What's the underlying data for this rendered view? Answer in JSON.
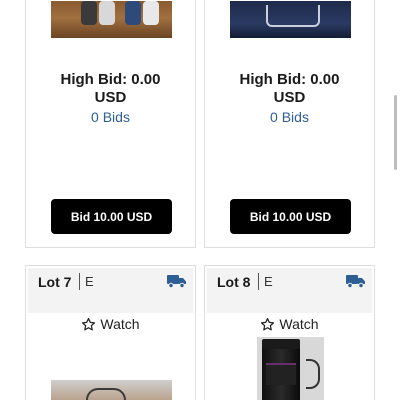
{
  "cards": [
    {
      "high_bid_label": "High Bid: 0.00",
      "currency": "USD",
      "bids_count": "0 Bids",
      "bid_button_label": "Bid 10.00 USD"
    },
    {
      "high_bid_label": "High Bid: 0.00",
      "currency": "USD",
      "bids_count": "0 Bids",
      "bid_button_label": "Bid 10.00 USD"
    },
    {
      "lot_label": "Lot 7",
      "lot_code": "E",
      "watch_label": "Watch"
    },
    {
      "lot_label": "Lot 8",
      "lot_code": "E",
      "watch_label": "Watch"
    }
  ],
  "colors": {
    "link": "#2d5e94",
    "button_bg": "#000000",
    "truck_icon": "#2d5e94",
    "header_bg": "#f3f3f3"
  },
  "icons": {
    "shipping": "truck-icon",
    "watch": "star-icon"
  }
}
